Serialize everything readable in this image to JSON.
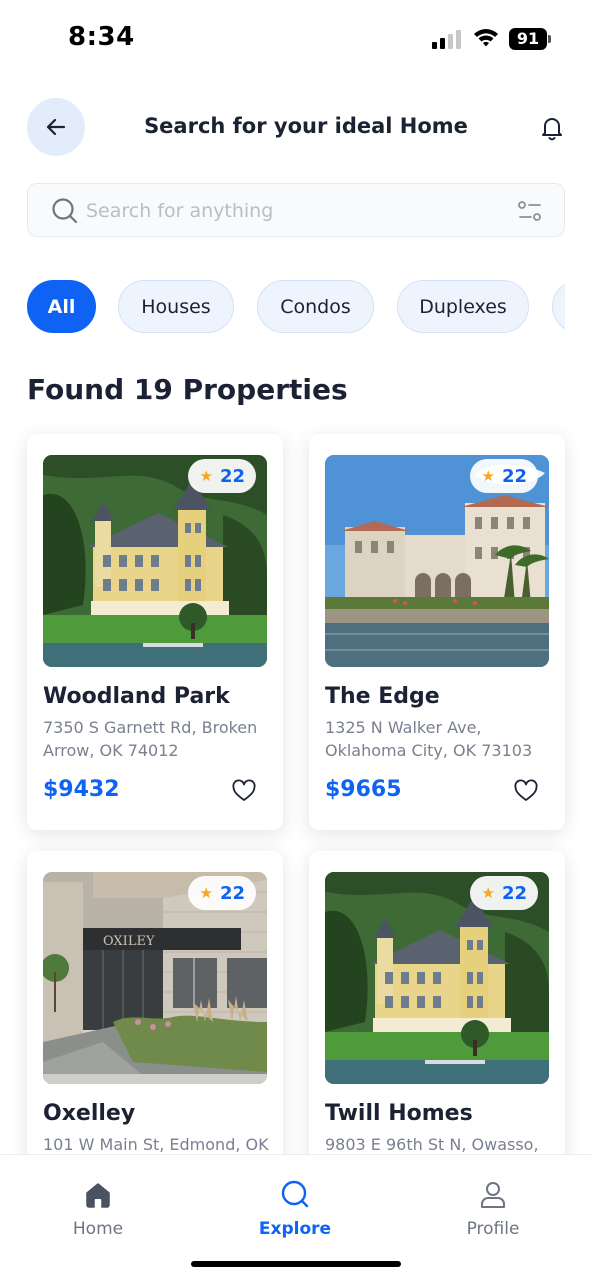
{
  "status_bar": {
    "time": "8:34",
    "battery": "91",
    "icons": [
      "signal-icon",
      "wifi-icon",
      "battery-icon"
    ]
  },
  "header": {
    "title": "Search for your ideal Home",
    "back_icon": "arrow-left-icon",
    "notification_icon": "bell-icon"
  },
  "search": {
    "placeholder": "Search for anything",
    "value": "",
    "icon": "search-icon",
    "filter_icon": "filter-icon"
  },
  "filters": {
    "chips": [
      {
        "label": "All",
        "active": true
      },
      {
        "label": "Houses",
        "active": false
      },
      {
        "label": "Condos",
        "active": false
      },
      {
        "label": "Duplexes",
        "active": false
      }
    ]
  },
  "results": {
    "title": "Found 19 Properties",
    "properties": [
      {
        "name": "Woodland Park",
        "address": "7350 S Garnett Rd, Broken Arrow, OK 74012",
        "price": "$9432",
        "rating": "22",
        "photo": "yellow-villa-by-lake",
        "favorite": false
      },
      {
        "name": "The Edge",
        "address": "1325 N Walker Ave, Oklahoma City, OK 73103",
        "price": "$9665",
        "rating": "22",
        "photo": "white-palace-waterfront",
        "favorite": false
      },
      {
        "name": "Oxelley",
        "address": "101 W Main St, Edmond, OK",
        "price": "",
        "rating": "22",
        "photo": "modern-brick-building",
        "favorite": false
      },
      {
        "name": "Twill Homes",
        "address": "9803 E 96th St N, Owasso,",
        "price": "",
        "rating": "22",
        "photo": "yellow-villa-by-lake",
        "favorite": false
      }
    ]
  },
  "bottom_nav": {
    "items": [
      {
        "label": "Home",
        "icon": "home-icon",
        "active": false
      },
      {
        "label": "Explore",
        "icon": "search-icon",
        "active": true
      },
      {
        "label": "Profile",
        "icon": "user-icon",
        "active": false
      }
    ]
  },
  "colors": {
    "accent": "#0e63f4",
    "chip_bg": "#eef4fd",
    "text": "#1b2233",
    "muted": "#7b8090",
    "star": "#f5a623"
  }
}
